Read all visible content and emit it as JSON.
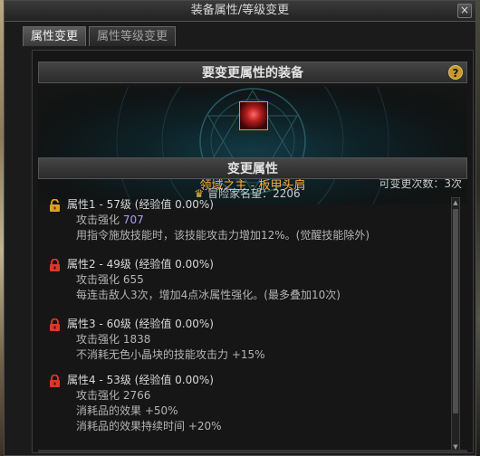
{
  "window": {
    "title": "装备属性/等级变更",
    "close_label": "×"
  },
  "tabs": [
    {
      "label": "属性变更",
      "active": true
    },
    {
      "label": "属性等级变更",
      "active": false
    }
  ],
  "equipment_section": {
    "header": "要变更属性的装备",
    "help_label": "?",
    "item_name": "领域之主 - 板甲头肩",
    "change_count": "可变更次数：3次"
  },
  "attributes_section": {
    "header": "变更属性",
    "reputation_label": "冒险家名望：2206",
    "items": [
      {
        "title": "属性1 - 57级 (经验值 0.00%)",
        "stat_label": "攻击强化",
        "stat_value": "707",
        "effects": [
          "用指令施放技能时，该技能攻击力增加12%。(觉醒技能除外)"
        ],
        "lock": "unlocked",
        "value_color": "#a99cff"
      },
      {
        "title": "属性2 - 49级 (经验值 0.00%)",
        "stat_label": "攻击强化",
        "stat_value": "655",
        "effects": [
          "每连击敌人3次，增加4点冰属性强化。(最多叠加10次)"
        ],
        "lock": "locked"
      },
      {
        "title": "属性3 - 60级 (经验值 0.00%)",
        "stat_label": "攻击强化",
        "stat_value": "1838",
        "effects": [
          "不消耗无色小晶块的技能攻击力 +15%"
        ],
        "lock": "locked"
      },
      {
        "title": "属性4 - 53级 (经验值 0.00%)",
        "stat_label": "攻击强化",
        "stat_value": "2766",
        "effects": [
          "消耗品的效果 +50%",
          "消耗品的效果持续时间 +20%"
        ],
        "lock": "locked"
      }
    ]
  },
  "colors": {
    "item_name": "#ffb03a",
    "accent_gold": "#c79a2a",
    "lock_red": "#d83a2a",
    "lock_gold": "#e0a020"
  },
  "icons": {
    "help": "question-icon",
    "lock_locked": "red-lock-icon",
    "lock_unlocked": "gold-unlocked-icon",
    "reputation": "crown-icon",
    "item": "shoulder-armor-icon"
  }
}
